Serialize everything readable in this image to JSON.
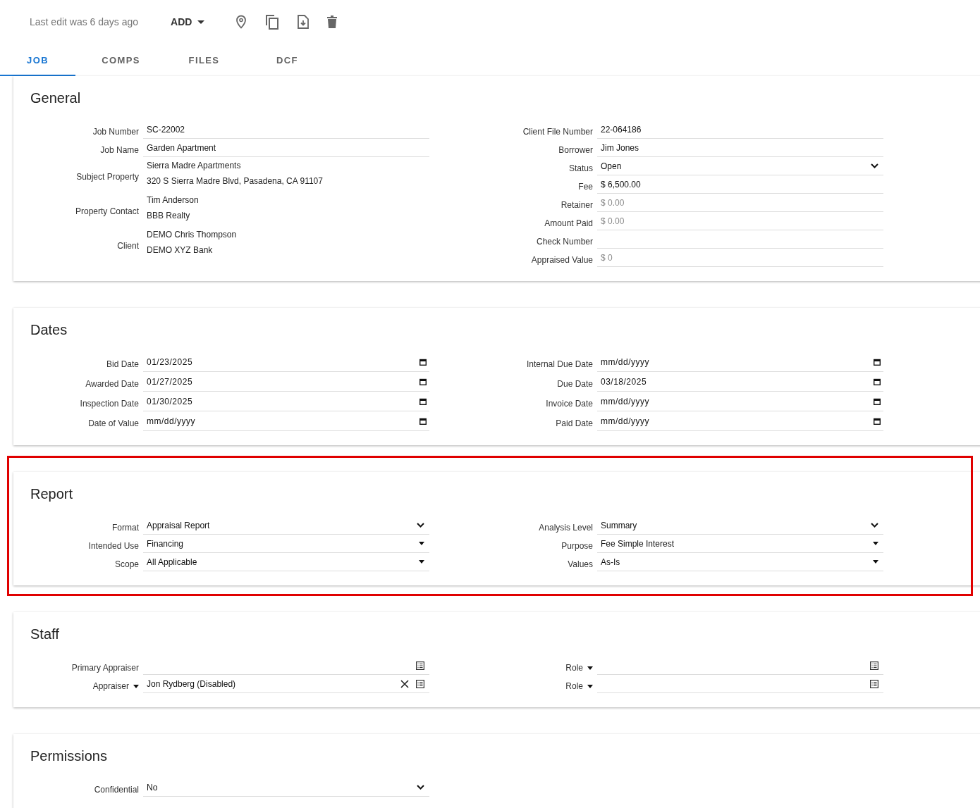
{
  "header": {
    "status": "Last edit was 6 days ago",
    "add_button": "ADD"
  },
  "tabs": [
    {
      "label": "JOB",
      "selected": true
    },
    {
      "label": "COMPS",
      "selected": false
    },
    {
      "label": "FILES",
      "selected": false
    },
    {
      "label": "DCF",
      "selected": false
    }
  ],
  "sections": [
    {
      "title": "General",
      "highlighted": false,
      "columns": [
        [
          {
            "kind": "text",
            "label": "Job Number",
            "value": "SC-22002"
          },
          {
            "kind": "text",
            "label": "Job Name",
            "value": "Garden Apartment"
          },
          {
            "kind": "lines",
            "label": "Subject Property",
            "lines": [
              "Sierra Madre Apartments",
              "320 S Sierra Madre Blvd, Pasadena, CA 91107"
            ]
          },
          {
            "kind": "lines",
            "label": "Property Contact",
            "lines": [
              "Tim Anderson",
              "BBB Realty"
            ]
          },
          {
            "kind": "lines",
            "label": "Client",
            "lines": [
              "DEMO Chris Thompson",
              "DEMO XYZ Bank"
            ]
          }
        ],
        [
          {
            "kind": "text",
            "label": "Client File Number",
            "value": "22-064186"
          },
          {
            "kind": "text",
            "label": "Borrower",
            "value": "Jim Jones"
          },
          {
            "kind": "select",
            "label": "Status",
            "value": "Open"
          },
          {
            "kind": "text",
            "label": "Fee",
            "value": "$ 6,500.00"
          },
          {
            "kind": "text",
            "label": "Retainer",
            "placeholder": "$ 0.00"
          },
          {
            "kind": "text",
            "label": "Amount Paid",
            "placeholder": "$ 0.00"
          },
          {
            "kind": "text",
            "label": "Check Number"
          },
          {
            "kind": "text",
            "label": "Appraised Value",
            "placeholder": "$ 0"
          }
        ]
      ]
    },
    {
      "title": "Dates",
      "highlighted": false,
      "columns": [
        [
          {
            "kind": "date",
            "label": "Bid Date",
            "value": "01/23/2025"
          },
          {
            "kind": "date",
            "label": "Awarded Date",
            "value": "01/27/2025"
          },
          {
            "kind": "date",
            "label": "Inspection Date",
            "value": "01/30/2025"
          },
          {
            "kind": "date",
            "label": "Date of Value",
            "placeholder": "mm/dd/yyyy"
          }
        ],
        [
          {
            "kind": "date",
            "label": "Internal Due Date",
            "placeholder": "mm/dd/yyyy"
          },
          {
            "kind": "date",
            "label": "Due Date",
            "value": "03/18/2025"
          },
          {
            "kind": "date",
            "label": "Invoice Date",
            "placeholder": "mm/dd/yyyy"
          },
          {
            "kind": "date",
            "label": "Paid Date",
            "placeholder": "mm/dd/yyyy"
          }
        ]
      ]
    },
    {
      "title": "Report",
      "highlighted": true,
      "columns": [
        [
          {
            "kind": "select",
            "label": "Format",
            "value": "Appraisal Report"
          },
          {
            "kind": "dropdown",
            "label": "Intended Use",
            "value": "Financing"
          },
          {
            "kind": "dropdown",
            "label": "Scope",
            "value": "All Applicable"
          }
        ],
        [
          {
            "kind": "select",
            "label": "Analysis Level",
            "value": "Summary"
          },
          {
            "kind": "dropdown",
            "label": "Purpose",
            "value": "Fee Simple Interest"
          },
          {
            "kind": "dropdown",
            "label": "Values",
            "value": "As-Is"
          }
        ]
      ]
    },
    {
      "title": "Staff",
      "highlighted": false,
      "columns": [
        [
          {
            "kind": "picker",
            "label": "Primary Appraiser",
            "label_menu": false,
            "clearable": false
          },
          {
            "kind": "picker",
            "label": "Appraiser",
            "label_menu": true,
            "value": "Jon Rydberg (Disabled)",
            "clearable": true
          }
        ],
        [
          {
            "kind": "picker",
            "label": "Role",
            "label_menu": true,
            "clearable": false
          },
          {
            "kind": "picker",
            "label": "Role",
            "label_menu": true,
            "clearable": false
          }
        ]
      ]
    },
    {
      "title": "Permissions",
      "highlighted": false,
      "columns": [
        [
          {
            "kind": "select",
            "label": "Confidential",
            "value": "No"
          }
        ]
      ]
    }
  ]
}
